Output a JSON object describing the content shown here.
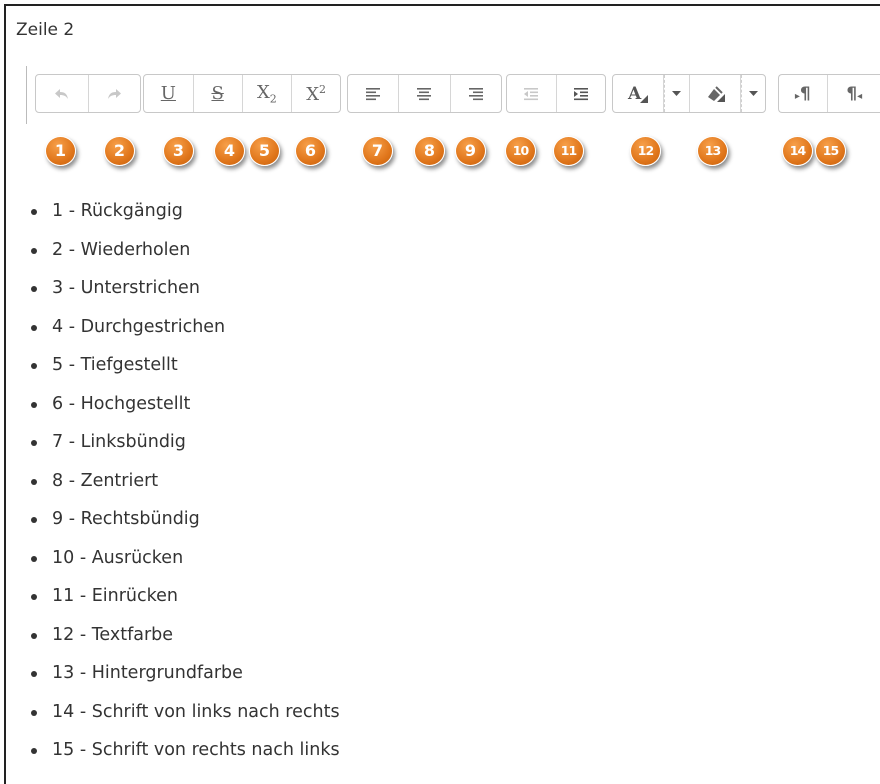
{
  "heading": "Zeile 2",
  "toolbar": {
    "undo_icon": "undo-arrow-icon",
    "redo_icon": "redo-arrow-icon",
    "underline_glyph": "U",
    "strikethrough_glyph": "S",
    "subscript_glyph": "X",
    "subscript_index": "2",
    "superscript_glyph": "X",
    "superscript_index": "2",
    "text_color_glyph": "A",
    "ltr_glyph": "¶",
    "rtl_glyph": "¶"
  },
  "badges": [
    "1",
    "2",
    "3",
    "4",
    "5",
    "6",
    "7",
    "8",
    "9",
    "10",
    "11",
    "12",
    "13",
    "14",
    "15"
  ],
  "colors": {
    "badge": "#e0761b",
    "text": "#333333",
    "disabled_icon": "#c8c8c8"
  },
  "items": [
    "1 - Rückgängig",
    "2 - Wiederholen",
    "3 - Unterstrichen",
    "4 - Durchgestrichen",
    "5 - Tiefgestellt",
    "6 - Hochgestellt",
    "7 - Linksbündig",
    "8 - Zentriert",
    "9 - Rechtsbündig",
    "10 - Ausrücken",
    "11 - Einrücken",
    "12 - Textfarbe",
    "13 - Hintergrundfarbe",
    "14 - Schrift von links nach rechts",
    "15 - Schrift von rechts nach links"
  ]
}
